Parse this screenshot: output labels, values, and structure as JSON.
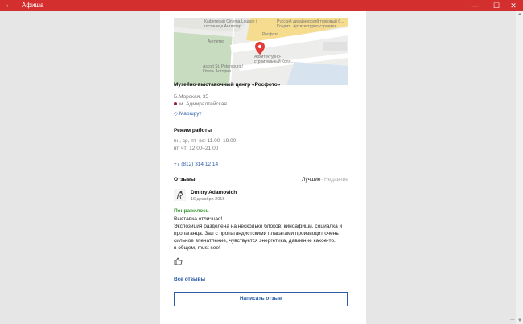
{
  "window": {
    "title": "Афиша",
    "back": "←",
    "minimize": "—",
    "maximize": "☐",
    "close": "✕"
  },
  "map": {
    "labels": [
      "Кафетерий Cinema Lounge /",
      "гостиница Англетер",
      "Русский дизайнерский торговый б...",
      "Кондит...Архитектурно-строител...",
      "Росфото",
      "Англетер",
      "Архитектурно-",
      "строительный Колл...",
      "Ascott St. Petersburg /",
      "Отель Астория"
    ]
  },
  "venue": {
    "name": "Музейно-выставочный центр «Росфото»",
    "address": "Б.Морская, 35",
    "metro": "м. Адмиралтейская",
    "route": "Маршрут"
  },
  "hours": {
    "title": "Режим работы",
    "lines": [
      "пн, ср, пт–вс: 11.00–19.00",
      "вт, чт: 12.00–21.00"
    ]
  },
  "phone": "+7 (812) 314 12 14",
  "reviews": {
    "title": "Отзывы",
    "sort_best": "Лучшие",
    "sort_sep": "·",
    "sort_recent": "Недавние",
    "author": "Dmitry Adamovich",
    "date": "16 декабря 2015",
    "verdict": "Понравилось",
    "text": [
      "Выставка отличная!",
      "Экспозиция разделена на несколько блоков: кинoафиши, социалка и",
      "пропаганда. Зал с пропагандистскими плакатами производит очень",
      "сильное впечатление, чувствуется энергетика, давление какое-то.",
      "в общем, must see!"
    ],
    "all": "Все отзывы",
    "write": "Написать отзыв"
  },
  "footer": "..."
}
